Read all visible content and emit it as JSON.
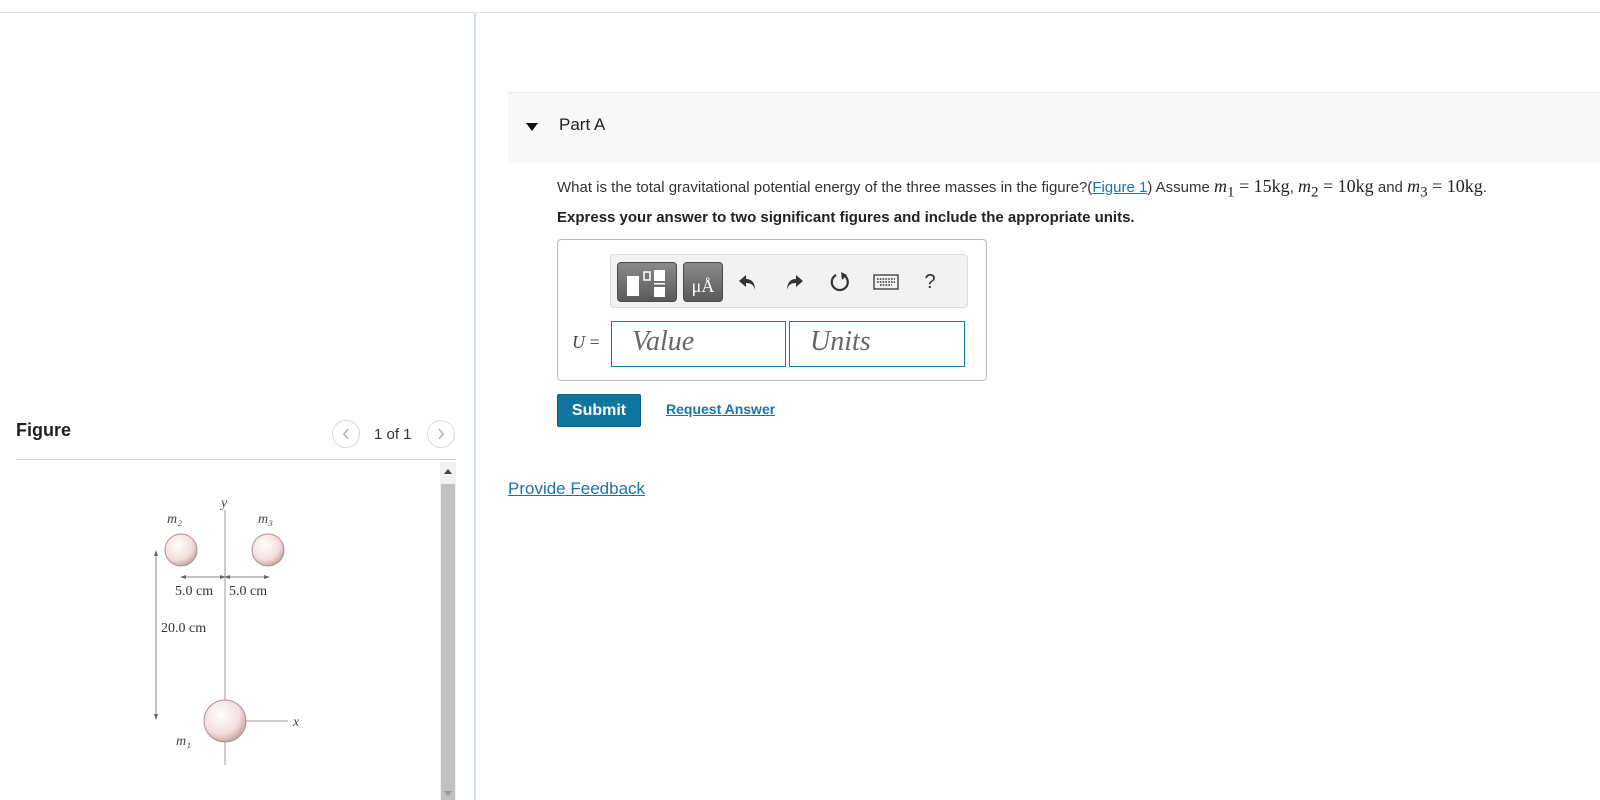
{
  "figure_panel": {
    "title": "Figure",
    "pager": "1 of 1",
    "labels": {
      "y_axis": "y",
      "x_axis": "x",
      "m1": "m₁",
      "m2": "m₂",
      "m3": "m₃",
      "dist_left": "5.0 cm",
      "dist_right": "5.0 cm",
      "dist_vertical": "20.0 cm"
    }
  },
  "part": {
    "label": "Part A"
  },
  "question": {
    "text": "What is the total gravitational potential energy of the three masses in the figure?(",
    "figure_link": "Figure 1",
    "assume": ") Assume ",
    "m1_sym": "m",
    "m1_sub": "1",
    "m1_val": " = 15kg",
    "sep1": ", ",
    "m2_sym": "m",
    "m2_sub": "2",
    "m2_val": " = 10kg",
    "and": " and ",
    "m3_sym": "m",
    "m3_sub": "3",
    "m3_val": " = 10kg",
    "end": "."
  },
  "instructions": "Express your answer to two significant figures and include the appropriate units.",
  "answer": {
    "variable": "U",
    "equals": " =",
    "value_placeholder": "Value",
    "units_placeholder": "Units",
    "units_button_label": "μÅ",
    "help_label": "?"
  },
  "icons": [
    "templates-icon",
    "undo-icon",
    "redo-icon",
    "reset-icon",
    "keyboard-icon",
    "chevron-left-icon",
    "chevron-right-icon",
    "caret-down-icon"
  ],
  "actions": {
    "submit": "Submit",
    "request_answer": "Request Answer",
    "provide_feedback": "Provide Feedback"
  },
  "colors": {
    "accent": "#0f76a0",
    "link": "#1a73b0"
  }
}
